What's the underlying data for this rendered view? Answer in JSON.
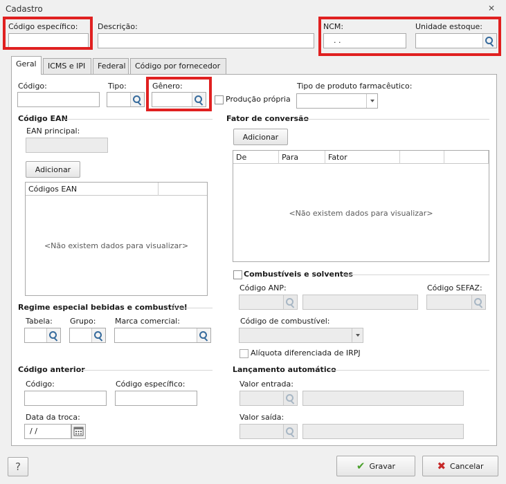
{
  "window": {
    "title": "Cadastro",
    "close_glyph": "✕"
  },
  "header": {
    "codigo_especifico_label": "Código específico:",
    "descricao_label": "Descrição:",
    "ncm_label": "NCM:",
    "ncm_value": ". .",
    "unidade_estoque_label": "Unidade estoque:"
  },
  "tabs": [
    {
      "label": "Geral"
    },
    {
      "label": "ICMS e IPI"
    },
    {
      "label": "Federal"
    },
    {
      "label": "Código por fornecedor"
    }
  ],
  "geral": {
    "codigo_label": "Código:",
    "tipo_label": "Tipo:",
    "genero_label": "Gênero:",
    "producao_propria_label": "Produção própria",
    "tipo_farmaceutico_label": "Tipo de produto farmacêutico:"
  },
  "ean": {
    "section_title": "Código EAN",
    "principal_label": "EAN principal:",
    "add_button": "Adicionar",
    "column_header": "Códigos EAN",
    "empty_message": "<Não existem dados para visualizar>"
  },
  "fator": {
    "section_title": "Fator de conversão",
    "add_button": "Adicionar",
    "columns": [
      "De",
      "Para",
      "Fator",
      "",
      ""
    ],
    "empty_message": "<Não existem dados para visualizar>"
  },
  "combustiveis": {
    "checkbox_label": "Combustíveis e solventes",
    "codigo_anp_label": "Código ANP:",
    "codigo_sefaz_label": "Código SEFAZ:",
    "codigo_combustivel_label": "Código de combustível:",
    "aliquota_label": "Alíquota diferenciada de IRPJ"
  },
  "regime": {
    "section_title": "Regime especial bebidas e combustível",
    "tabela_label": "Tabela:",
    "grupo_label": "Grupo:",
    "marca_label": "Marca comercial:"
  },
  "anterior": {
    "section_title": "Código anterior",
    "codigo_label": "Código:",
    "codigo_especifico_label": "Código específico:",
    "data_troca_label": "Data da troca:",
    "data_troca_value": "/ /"
  },
  "lancamento": {
    "section_title": "Lançamento automático",
    "valor_entrada_label": "Valor entrada:",
    "valor_saida_label": "Valor saída:"
  },
  "footer": {
    "help_label": "?",
    "gravar_label": "Gravar",
    "cancelar_label": "Cancelar"
  },
  "colors": {
    "highlight": "#e02020",
    "search_icon": "#356a9c",
    "gravar_check": "#4aa02c",
    "cancelar_x": "#c62828"
  }
}
